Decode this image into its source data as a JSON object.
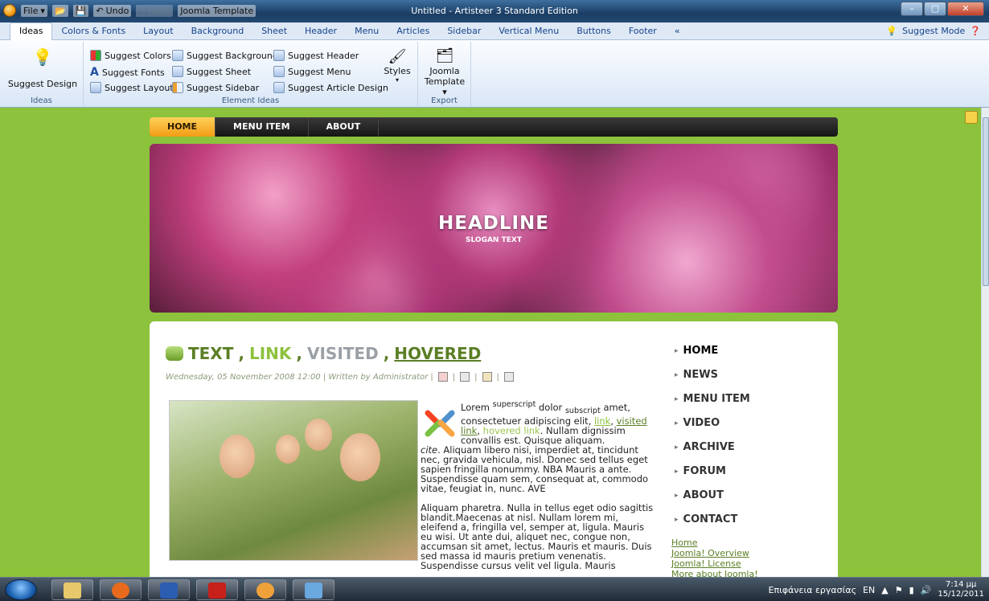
{
  "titlebar": {
    "file_label": "File",
    "undo_label": "Undo",
    "redo_label": "Redo",
    "template_label": "Joomla Template",
    "window_title": "Untitled - Artisteer 3 Standard Edition"
  },
  "tabs": [
    "Ideas",
    "Colors & Fonts",
    "Layout",
    "Background",
    "Sheet",
    "Header",
    "Menu",
    "Articles",
    "Sidebar",
    "Vertical Menu",
    "Buttons",
    "Footer",
    "«"
  ],
  "suggest_mode": "Suggest Mode",
  "ribbon": {
    "suggest_design": "Suggest Design",
    "ideas_group": "Ideas",
    "suggest_colors": "Suggest Colors",
    "suggest_fonts": "Suggest Fonts",
    "suggest_layout": "Suggest Layout",
    "suggest_background": "Suggest Background",
    "suggest_sheet": "Suggest Sheet",
    "suggest_sidebar": "Suggest Sidebar",
    "suggest_header": "Suggest Header",
    "suggest_menu": "Suggest Menu",
    "suggest_article_design": "Suggest Article Design",
    "styles": "Styles",
    "element_ideas_group": "Element Ideas",
    "joomla": "Joomla",
    "template": "Template",
    "export_group": "Export"
  },
  "site": {
    "top_menu": [
      "HOME",
      "MENU ITEM",
      "ABOUT"
    ],
    "headline": "HEADLINE",
    "slogan": "SLOGAN TEXT",
    "post": {
      "title_text": "TEXT",
      "title_link": "LINK",
      "title_visited": "VISITED",
      "title_hovered": "HOVERED",
      "meta": "Wednesday, 05 November 2008 12:00 | Written by Administrator |",
      "p1_a": "Lorem",
      "p1_sup": "superscript",
      "p1_b": "dolor",
      "p1_sub": "subscript",
      "p1_c": "amet, consectetuer adipiscing elit,",
      "link": "link",
      "visited_link": "visited link",
      "hovered_link": "hovered link",
      "p1_d": "Nullam dignissim convallis est. Quisque aliquam.",
      "cite": "cite",
      "p1_e": ". Aliquam libero nisi, imperdiet at, tincidunt nec, gravida vehicula, nisl. Donec sed tellus eget sapien fringilla nonummy. NBA Mauris a ante. Suspendisse quam sem, consequat at, commodo vitae, feugiat in, nunc. AVE",
      "p2": "Aliquam pharetra. Nulla in tellus eget odio sagittis blandit.Maecenas at nisl. Nullam lorem mi, eleifend a, fringilla vel, semper at, ligula. Mauris eu wisi. Ut ante dui, aliquet nec, congue non, accumsan sit amet, lectus. Mauris et mauris. Duis sed massa id mauris pretium venenatis. Suspendisse cursus velit vel ligula. Mauris"
    },
    "sidebar_nav": [
      "HOME",
      "NEWS",
      "MENU ITEM",
      "VIDEO",
      "ARCHIVE",
      "FORUM",
      "ABOUT",
      "CONTACT"
    ],
    "sidebar_links": [
      "Home",
      "Joomla! Overview",
      "Joomla! License",
      "More about Joomla!"
    ]
  },
  "taskbar": {
    "desktop_label": "Επιφάνεια εργασίας",
    "lang": "EN",
    "time": "7:14 μμ",
    "date": "15/12/2011"
  },
  "colors": {
    "accent_green": "#8cc23c",
    "link_green": "#5b7f25",
    "menu_active": "#f19c14"
  }
}
